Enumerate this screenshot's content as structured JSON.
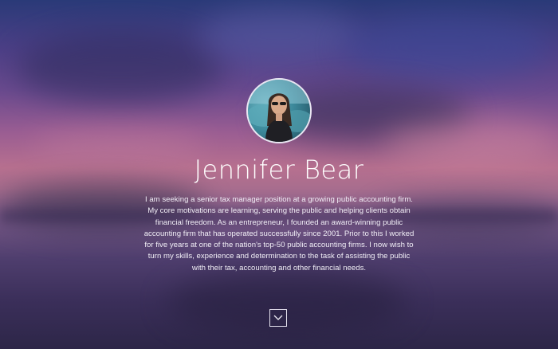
{
  "profile": {
    "name": "Jennifer Bear",
    "bio": "I am seeking a senior tax manager position at a growing public accounting firm. My core motivations are learning, serving the public and helping clients obtain financial freedom. As an entrepreneur, I founded an award-winning public accounting firm that has operated successfully since 2001. Prior to this I worked for five years at one of the nation's top-50 public accounting firms. I now wish to turn my skills, experience and determination to the task of assisting the public with their tax, accounting and other financial needs.",
    "avatar_icon": "profile-photo"
  },
  "scroll_down": {
    "icon": "chevron-down-icon"
  },
  "colors": {
    "text": "#ffffff",
    "sky_top": "#2a3a78",
    "sky_glow": "#b7708f",
    "water": "#2d2648"
  }
}
